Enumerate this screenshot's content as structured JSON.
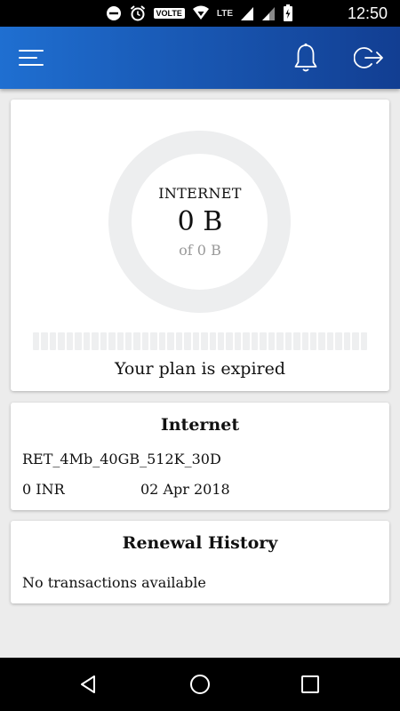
{
  "status_bar": {
    "time": "12:50",
    "volte": "VOLTE",
    "network": "LTE",
    "icons": [
      "dnd-icon",
      "alarm-icon",
      "volte-icon",
      "wifi-icon",
      "signal-icon",
      "signal-icon",
      "battery-icon"
    ]
  },
  "app_bar": {
    "icons": [
      "menu-icon",
      "bell-icon",
      "logout-icon"
    ],
    "color_start": "#1f6fd1",
    "color_end": "#123e92"
  },
  "usage_card": {
    "category": "INTERNET",
    "used": "0 B",
    "total": "of 0 B",
    "usage_fraction": 0,
    "segment_count": 40,
    "status": "Your plan is expired"
  },
  "plan_card": {
    "title": "Internet",
    "plan_name": "RET_4Mb_40GB_512K_30D",
    "price": "0 INR",
    "date": "02 Apr 2018"
  },
  "renewal_card": {
    "title": "Renewal History",
    "message": "No transactions available"
  },
  "nav_bar": {
    "icons": [
      "back-icon",
      "home-icon",
      "recents-icon"
    ]
  }
}
